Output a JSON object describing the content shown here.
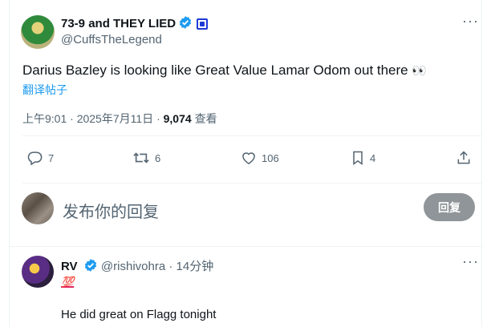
{
  "tweet": {
    "author_name": "73-9 and THEY LIED",
    "handle": "@CuffsTheLegend",
    "text": "Darius Bazley is looking like Great Value Lamar Odom out there",
    "text_emoji": "👀",
    "translate_label": "翻译帖子",
    "time": "上午9:01",
    "date": "2025年7月11日",
    "views_count": "9,074",
    "views_label": "查看",
    "separator": "·"
  },
  "actions": {
    "reply_count": "7",
    "retweet_count": "6",
    "like_count": "106",
    "bookmark_count": "4"
  },
  "composer": {
    "placeholder": "发布你的回复",
    "button_label": "回复"
  },
  "reply": {
    "name": "RV",
    "handle": "@rishivohra",
    "separator": "·",
    "time": "14分钟",
    "emoji": "💯",
    "text": "He did great on Flagg tonight"
  },
  "colors": {
    "accent": "#1d9bf0",
    "muted": "#536471",
    "button_bg": "#8f9598",
    "affiliate_badge": "#1d3ad6"
  }
}
